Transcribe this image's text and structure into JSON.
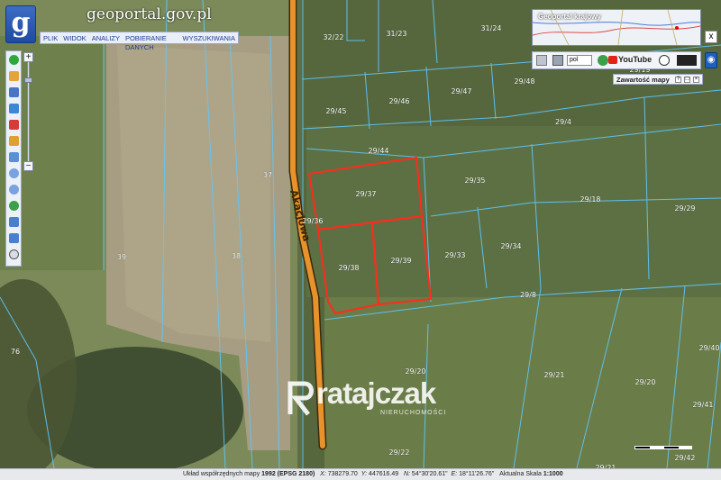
{
  "header": {
    "logo_letter": "g",
    "site_title": "geoportal.gov.pl",
    "menu": [
      "PLIK",
      "WIDOK",
      "ANALIZY",
      "POBIERANIE DANYCH",
      "WYSZUKIWANIA"
    ]
  },
  "overview": {
    "title": "Geoportal krajowy",
    "close_label": "x"
  },
  "right_tools": {
    "language": "pol",
    "youtube_label": "YouTube",
    "contents_label": "Zawartość mapy",
    "contents_buttons": [
      "?",
      "□",
      "×"
    ]
  },
  "zoom": {
    "plus": "+",
    "minus": "−"
  },
  "road_name": "Akacjowa",
  "parcels": [
    "32/22",
    "31/23",
    "31/24",
    "29/19",
    "29/48",
    "29/45",
    "29/46",
    "29/47",
    "29/4",
    "29/44",
    "29/37",
    "29/35",
    "29/18",
    "29/29",
    "37",
    "29/36",
    "29/38",
    "29/39",
    "29/33",
    "29/34",
    "39",
    "38",
    "29/8",
    "76",
    "29/40",
    "29/20",
    "29/21",
    "29/20",
    "29/41",
    "29/22",
    "29/42",
    "29/21"
  ],
  "watermark": {
    "name": "ratajczak",
    "sub": "NIERUCHOMOŚCI"
  },
  "statusbar": {
    "system_label": "Układ współrzędnych mapy",
    "system_value": "1992 (EPSG 2180)",
    "x_label": "X:",
    "x_value": "738279.70",
    "y_label": "Y:",
    "y_value": "447616.49",
    "n_label": "N:",
    "n_value": "54°30'20.61\"",
    "e_label": "E:",
    "e_value": "18°11'26.76\"",
    "scale_label": "Aktualna Skala",
    "scale_value": "1:1000"
  },
  "colors": {
    "highlight": "#ff2b1c",
    "road": "#e8922c",
    "parcel_line": "#5ec8ff"
  }
}
